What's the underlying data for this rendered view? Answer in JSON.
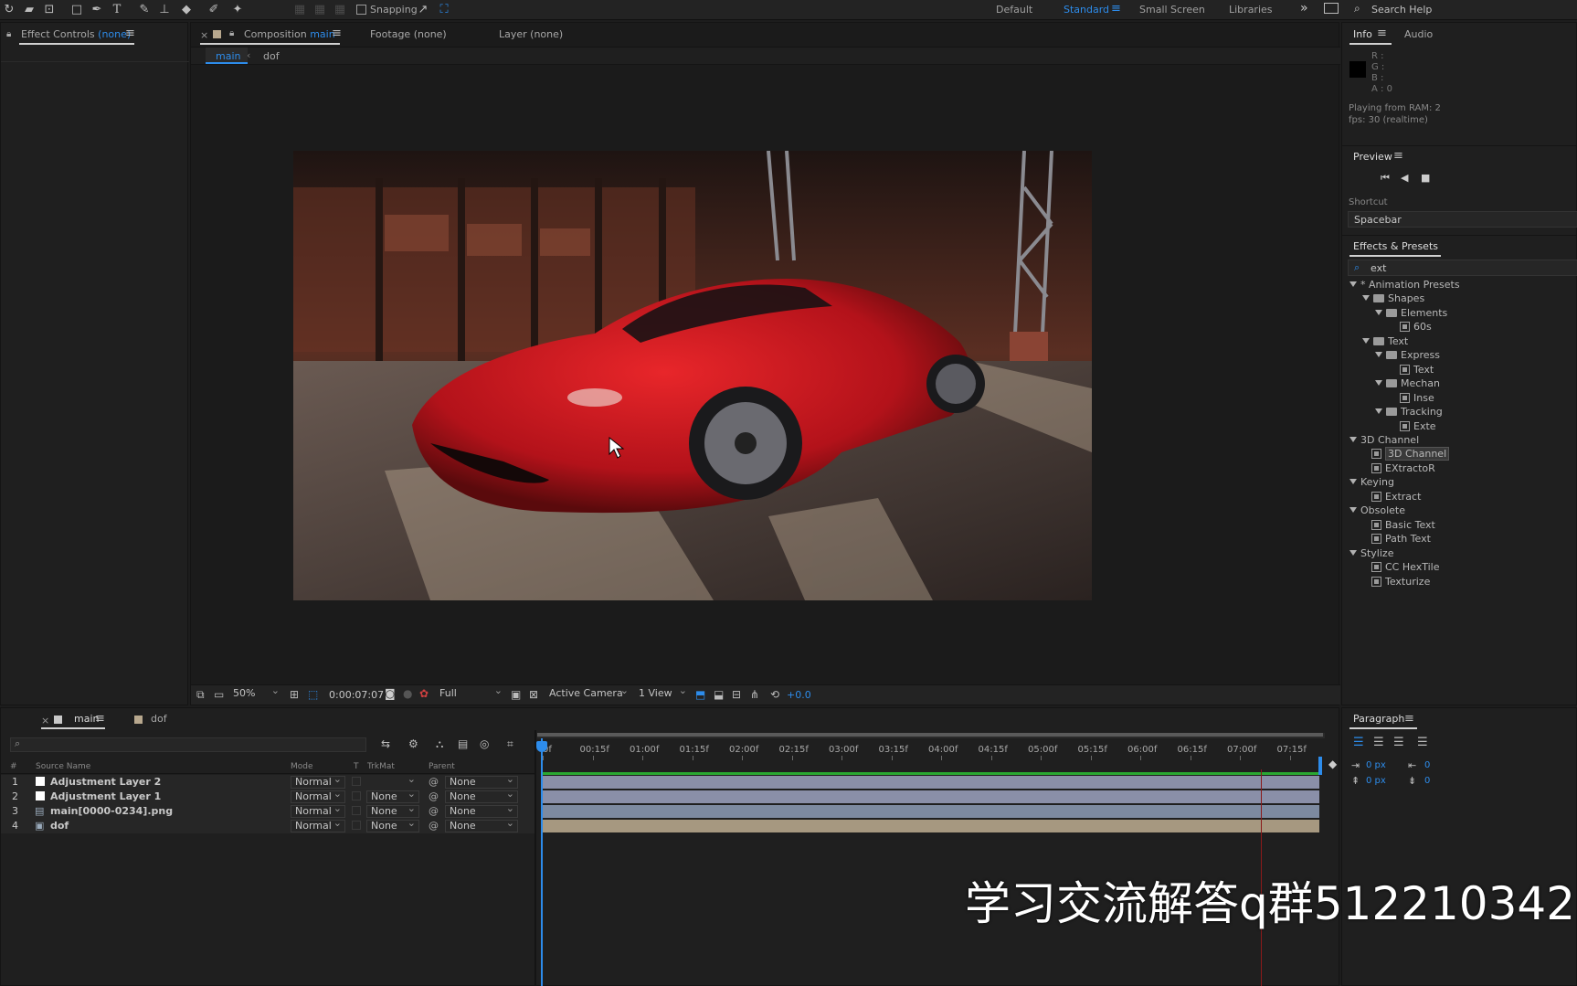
{
  "toolbar": {
    "tools": [
      "rotate-tool",
      "camera-tool",
      "pan-behind-tool",
      "rectangle-tool",
      "pen-tool",
      "type-tool",
      "brush-tool",
      "clone-stamp-tool",
      "eraser-tool",
      "roto-brush-tool",
      "puppet-pin-tool"
    ],
    "snapping_label": "Snapping",
    "workspaces": [
      "Default",
      "Standard",
      "Small Screen",
      "Libraries"
    ],
    "active_workspace": "Standard",
    "search_label": "Search Help"
  },
  "effect_controls": {
    "label": "Effect Controls",
    "value": "(none)"
  },
  "viewer": {
    "tabs": [
      {
        "label": "Composition",
        "value": "main"
      },
      {
        "label": "Footage (none)"
      },
      {
        "label": "Layer (none)"
      }
    ],
    "breadcrumbs": [
      "main",
      "dof"
    ],
    "zoom": "50%",
    "timecode": "0:00:07:07",
    "resolution": "Full",
    "camera": "Active Camera",
    "views": "1 View",
    "exposure": "+0.0"
  },
  "info": {
    "tabs": [
      "Info",
      "Audio"
    ],
    "channels": [
      "R :",
      "G :",
      "B :",
      "A : 0"
    ],
    "status_line1": "Playing from RAM: 2",
    "status_line2": "fps: 30 (realtime)"
  },
  "preview": {
    "title": "Preview",
    "shortcut_label": "Shortcut",
    "shortcut_value": "Spacebar"
  },
  "effects_presets": {
    "title": "Effects & Presets",
    "search_value": "ext",
    "tree": [
      {
        "label": "* Animation Presets",
        "kind": "category",
        "level": 0
      },
      {
        "label": "Shapes",
        "kind": "folder",
        "level": 1
      },
      {
        "label": "Elements",
        "kind": "folder",
        "level": 2
      },
      {
        "label": "60s",
        "kind": "preset",
        "level": 3
      },
      {
        "label": "Text",
        "kind": "folder",
        "level": 1
      },
      {
        "label": "Express",
        "kind": "folder",
        "level": 2
      },
      {
        "label": "Text",
        "kind": "preset",
        "level": 3
      },
      {
        "label": "Mechan",
        "kind": "folder",
        "level": 2
      },
      {
        "label": "Inse",
        "kind": "preset",
        "level": 3
      },
      {
        "label": "Tracking",
        "kind": "folder",
        "level": 2
      },
      {
        "label": "Exte",
        "kind": "preset",
        "level": 3
      },
      {
        "label": "3D Channel",
        "kind": "category",
        "level": 0
      },
      {
        "label": "3D Channel",
        "kind": "effect",
        "level": 1,
        "selected": true
      },
      {
        "label": "EXtractoR",
        "kind": "effect",
        "level": 1
      },
      {
        "label": "Keying",
        "kind": "category",
        "level": 0
      },
      {
        "label": "Extract",
        "kind": "effect",
        "level": 1
      },
      {
        "label": "Obsolete",
        "kind": "category",
        "level": 0
      },
      {
        "label": "Basic Text",
        "kind": "effect",
        "level": 1
      },
      {
        "label": "Path Text",
        "kind": "effect",
        "level": 1
      },
      {
        "label": "Stylize",
        "kind": "category",
        "level": 0
      },
      {
        "label": "CC HexTile",
        "kind": "effect",
        "level": 1
      },
      {
        "label": "Texturize",
        "kind": "effect",
        "level": 1
      }
    ]
  },
  "timeline": {
    "tabs": [
      "main",
      "dof"
    ],
    "columns": [
      "#",
      "Source Name",
      "Mode",
      "T",
      "TrkMat",
      "Parent"
    ],
    "layers": [
      {
        "num": "1",
        "name": "Adjustment Layer 2",
        "mode": "Normal",
        "trkmat": "",
        "parent": "None"
      },
      {
        "num": "2",
        "name": "Adjustment Layer 1",
        "mode": "Normal",
        "trkmat": "None",
        "parent": "None"
      },
      {
        "num": "3",
        "name": "main[0000-0234].png",
        "mode": "Normal",
        "trkmat": "None",
        "parent": "None"
      },
      {
        "num": "4",
        "name": "dof",
        "mode": "Normal",
        "trkmat": "None",
        "parent": "None"
      }
    ],
    "ruler": [
      "0f",
      "00:15f",
      "01:00f",
      "01:15f",
      "02:00f",
      "02:15f",
      "03:00f",
      "03:15f",
      "04:00f",
      "04:15f",
      "05:00f",
      "05:15f",
      "06:00f",
      "06:15f",
      "07:00f",
      "07:15f"
    ]
  },
  "paragraph": {
    "title": "Paragraph",
    "indent1": "0 px",
    "indent2": "0 px",
    "indent3": "0",
    "indent4": "0"
  },
  "watermark": "学习交流解答q群512210342"
}
